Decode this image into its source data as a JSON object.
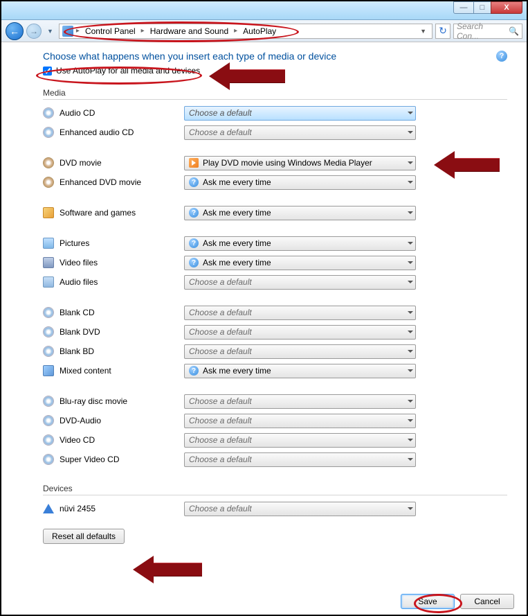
{
  "window": {
    "breadcrumb": {
      "parts": [
        "Control Panel",
        "Hardware and Sound",
        "AutoPlay"
      ]
    },
    "search_placeholder": "Search Con...",
    "min_label": "—",
    "max_label": "□",
    "close_label": "X"
  },
  "heading": "Choose what happens when you insert each type of media or device",
  "checkbox_label": "Use AutoPlay for all media and devices",
  "checkbox_checked": true,
  "choose_default": "Choose a default",
  "sections": {
    "media": {
      "title": "Media",
      "items": [
        {
          "label": "Audio CD",
          "value": "",
          "icon": "icon-cd",
          "highlight": true
        },
        {
          "label": "Enhanced audio CD",
          "value": "",
          "icon": "icon-cd"
        },
        {
          "label": "DVD movie",
          "value": "Play DVD movie using Windows Media Player",
          "icon": "icon-dvd",
          "value_icon": "play",
          "gap_before": true
        },
        {
          "label": "Enhanced DVD movie",
          "value": "Ask me every time",
          "icon": "icon-dvd",
          "value_icon": "q"
        },
        {
          "label": "Software and games",
          "value": "Ask me every time",
          "icon": "icon-sw",
          "value_icon": "q",
          "gap_before": true
        },
        {
          "label": "Pictures",
          "value": "Ask me every time",
          "icon": "icon-pic",
          "value_icon": "q",
          "gap_before": true
        },
        {
          "label": "Video files",
          "value": "Ask me every time",
          "icon": "icon-vid",
          "value_icon": "q"
        },
        {
          "label": "Audio files",
          "value": "",
          "icon": "icon-aud"
        },
        {
          "label": "Blank CD",
          "value": "",
          "icon": "icon-cd",
          "gap_before": true
        },
        {
          "label": "Blank DVD",
          "value": "",
          "icon": "icon-cd"
        },
        {
          "label": "Blank BD",
          "value": "",
          "icon": "icon-cd"
        },
        {
          "label": "Mixed content",
          "value": "Ask me every time",
          "icon": "icon-mix",
          "value_icon": "q"
        },
        {
          "label": "Blu-ray disc movie",
          "value": "",
          "icon": "icon-cd",
          "gap_before": true
        },
        {
          "label": "DVD-Audio",
          "value": "",
          "icon": "icon-cd"
        },
        {
          "label": "Video CD",
          "value": "",
          "icon": "icon-cd"
        },
        {
          "label": "Super Video CD",
          "value": "",
          "icon": "icon-cd"
        }
      ]
    },
    "devices": {
      "title": "Devices",
      "items": [
        {
          "label": "nüvi 2455",
          "value": "",
          "icon": "icon-nuvi"
        }
      ]
    }
  },
  "buttons": {
    "reset": "Reset all defaults",
    "save": "Save",
    "cancel": "Cancel"
  }
}
